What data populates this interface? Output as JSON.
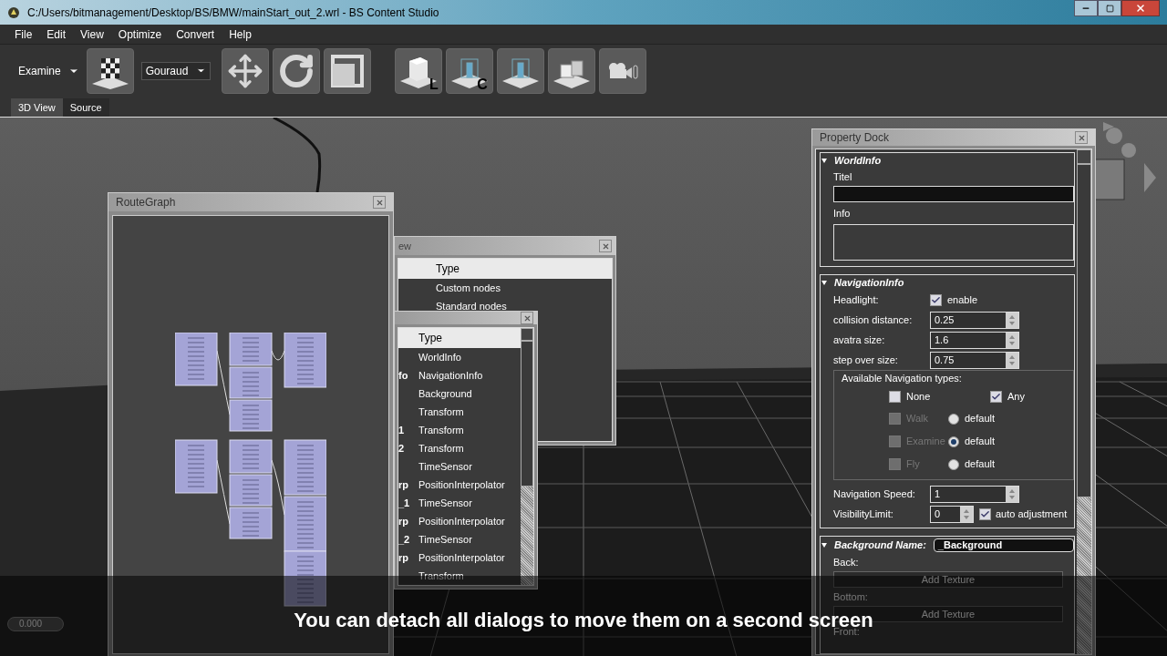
{
  "window": {
    "title": "C:/Users/bitmanagement/Desktop/BS/BMW/mainStart_out_2.wrl - BS Content Studio"
  },
  "menu": [
    "File",
    "Edit",
    "View",
    "Optimize",
    "Convert",
    "Help"
  ],
  "toolbar": {
    "navigation_mode": "Examine",
    "shading": "Gouraud",
    "light_badge": "L",
    "camera_badge": "C"
  },
  "view_tabs": [
    {
      "label": "3D View",
      "selected": true
    },
    {
      "label": "Source",
      "selected": false
    }
  ],
  "route_graph": {
    "title": "RouteGraph"
  },
  "node_view": {
    "title": "ew",
    "header": "Type",
    "rows": [
      "Custom nodes",
      "Standard nodes"
    ]
  },
  "node_list": {
    "header": "Type",
    "rows": [
      {
        "name": "",
        "type": "WorldInfo"
      },
      {
        "name": "fo",
        "type": "NavigationInfo"
      },
      {
        "name": "",
        "type": "Background"
      },
      {
        "name": "",
        "type": "Transform"
      },
      {
        "name": "1",
        "type": "Transform"
      },
      {
        "name": "2",
        "type": "Transform"
      },
      {
        "name": "",
        "type": "TimeSensor"
      },
      {
        "name": "rp",
        "type": "PositionInterpolator"
      },
      {
        "name": "_1",
        "type": "TimeSensor"
      },
      {
        "name": "rp",
        "type": "PositionInterpolator"
      },
      {
        "name": "_2",
        "type": "TimeSensor"
      },
      {
        "name": "rp",
        "type": "PositionInterpolator"
      },
      {
        "name": "",
        "type": "Transform"
      }
    ]
  },
  "property_dock": {
    "title": "Property Dock",
    "world_info": {
      "heading": "WorldInfo",
      "title_label": "Titel",
      "info_label": "Info"
    },
    "navigation_info": {
      "heading": "NavigationInfo",
      "headlight_label": "Headlight:",
      "headlight": {
        "label": "enable",
        "checked": true
      },
      "fields": [
        {
          "label": "collision distance:",
          "value": "0.25"
        },
        {
          "label": "avatra size:",
          "value": "1.6"
        },
        {
          "label": "step over size:",
          "value": "0.75"
        }
      ],
      "types_group": {
        "title": "Available Navigation types:",
        "none": {
          "label": "None",
          "checked": false
        },
        "any": {
          "label": "Any",
          "checked": true
        },
        "types": [
          {
            "label": "Walk",
            "checked": false,
            "disabled": true,
            "default_label": "default",
            "selected": false
          },
          {
            "label": "Examine",
            "checked": false,
            "disabled": true,
            "default_label": "default",
            "selected": true
          },
          {
            "label": "Fly",
            "checked": false,
            "disabled": true,
            "default_label": "default",
            "selected": false
          }
        ]
      },
      "speed": {
        "label": "Navigation Speed:",
        "value": "1"
      },
      "visibility": {
        "label": "VisibilityLimit:",
        "value": "0"
      },
      "auto_adjust": {
        "label": "auto adjustment",
        "checked": true
      }
    },
    "background": {
      "heading": "Background Name:",
      "name": "_Background",
      "sections": [
        {
          "label": "Back:",
          "button": "Add Texture"
        },
        {
          "label": "Bottom:",
          "button": "Add Texture"
        },
        {
          "label": "Front:"
        }
      ]
    }
  },
  "status_field": "0.000",
  "caption": "You can detach all dialogs to move them on a second screen"
}
